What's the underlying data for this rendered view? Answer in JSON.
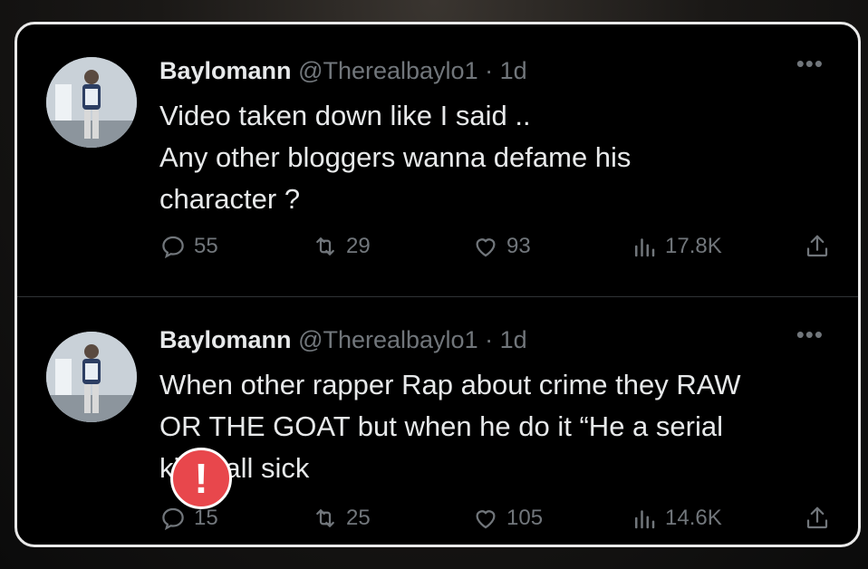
{
  "tweets": [
    {
      "display_name": "Baylomann",
      "handle": "@Therealbaylo1",
      "time": "· 1d",
      "more": "•••",
      "text": "Video taken down like I said ..\nAny other bloggers wanna defame his\ncharacter ?",
      "replies": "55",
      "retweets": "29",
      "likes": "93",
      "views": "17.8K"
    },
    {
      "display_name": "Baylomann",
      "handle": "@Therealbaylo1",
      "time": "· 1d",
      "more": "•••",
      "text": "When other rapper Rap about crime they RAW\nOR THE GOAT but when he do it “He a serial\nki     “ y’all sick",
      "replies": "15",
      "retweets": "25",
      "likes": "105",
      "views": "14.6K"
    }
  ],
  "overlay": {
    "alert_icon": "alert-icon",
    "alert_symbol": "!"
  },
  "colors": {
    "background": "#000000",
    "text": "#e7e9ea",
    "muted": "#71767b",
    "alert": "#e8474c"
  }
}
